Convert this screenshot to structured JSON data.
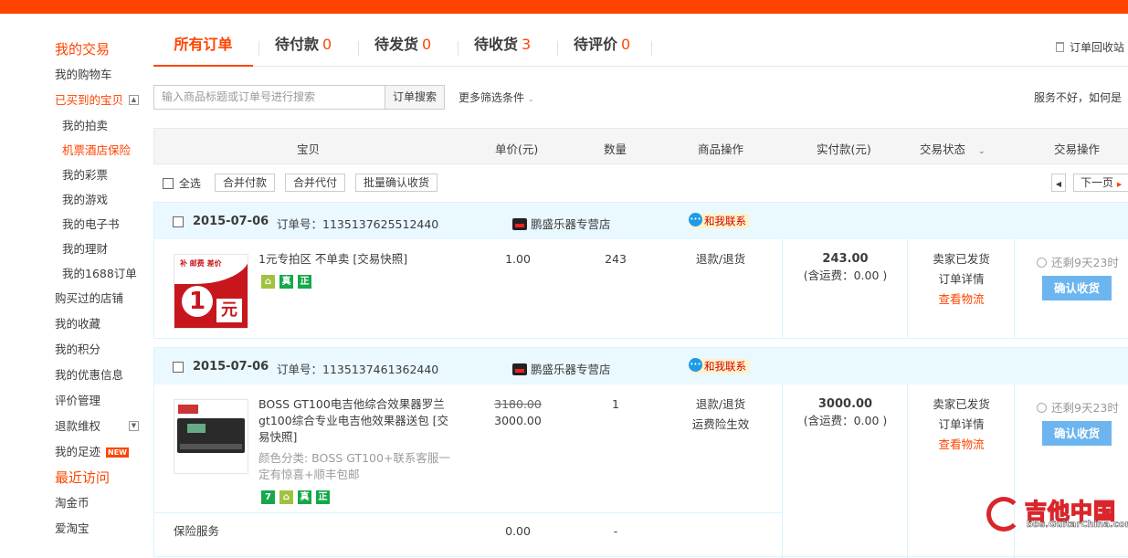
{
  "sidebar": {
    "heading1": "我的交易",
    "cart": "我的购物车",
    "bought": "已买到的宝贝",
    "sub": [
      "我的拍卖",
      "机票酒店保险",
      "我的彩票",
      "我的游戏",
      "我的电子书",
      "我的理财",
      "我的1688订单"
    ],
    "items": [
      "购买过的店铺",
      "我的收藏",
      "我的积分",
      "我的优惠信息",
      "评价管理",
      "退款维权",
      "我的足迹"
    ],
    "new_badge": "NEW",
    "heading2": "最近访问",
    "recent": [
      "淘金币",
      "爱淘宝"
    ]
  },
  "tabs": [
    {
      "label": "所有订单",
      "count": ""
    },
    {
      "label": "待付款",
      "count": "0"
    },
    {
      "label": "待发货",
      "count": "0"
    },
    {
      "label": "待收货",
      "count": "3"
    },
    {
      "label": "待评价",
      "count": "0"
    }
  ],
  "recycle": "订单回收站",
  "search": {
    "placeholder": "输入商品标题或订单号进行搜索",
    "button": "订单搜索",
    "more": "更多筛选条件",
    "complain": "服务不好，如何是"
  },
  "columns": [
    "宝贝",
    "单价(元)",
    "数量",
    "商品操作",
    "实付款(元)",
    "交易状态",
    "交易操作"
  ],
  "toolbar": {
    "select_all": "全选",
    "merge_pay": "合并付款",
    "merge_proxy": "合并代付",
    "batch_confirm": "批量确认收货",
    "next_page": "下一页"
  },
  "orders": [
    {
      "date": "2015-07-06",
      "order_no_label": "订单号：",
      "order_no": "1135137625512440",
      "shop": "鹏盛乐器专营店",
      "contact": "和我联系",
      "title": "1元专拍区 不单卖 [交易快照]",
      "thumb_top": "补 邮费 差价",
      "thumb_big": "1",
      "thumb_unit": "元",
      "tags": [
        "⌂",
        "真",
        "正"
      ],
      "price": "1.00",
      "qty": "243",
      "op": "退款/退货",
      "paid": "243.00",
      "shipping": "(含运费：0.00 )",
      "status": "卖家已发货",
      "detail": "订单详情",
      "logistics": "查看物流",
      "timer": "还剩9天23时",
      "confirm": "确认收货"
    },
    {
      "date": "2015-07-06",
      "order_no_label": "订单号：",
      "order_no": "1135137461362440",
      "shop": "鹏盛乐器专营店",
      "contact": "和我联系",
      "title": "BOSS GT100电吉他综合效果器罗兰gt100综合专业电吉他效果器送包 [交易快照]",
      "variant": "颜色分类: BOSS GT100+联系客服一定有惊喜+顺丰包邮",
      "tags": [
        "7",
        "⌂",
        "真",
        "正"
      ],
      "orig_price": "3180.00",
      "price": "3000.00",
      "qty": "1",
      "op": "退款/退货",
      "op2": "运费险生效",
      "paid": "3000.00",
      "shipping": "(含运费：0.00 )",
      "status": "卖家已发货",
      "detail": "订单详情",
      "logistics": "查看物流",
      "timer": "还剩9天23时",
      "confirm": "确认收货",
      "service": "保险服务",
      "service_price": "0.00",
      "service_qty": "-"
    }
  ],
  "watermark": {
    "name": "吉他中国",
    "url": "bbs.GuitarChina.com"
  },
  "colors": {
    "accent": "#ff4400",
    "header_bg": "#eaf8ff",
    "button": "#6cb5ef"
  }
}
